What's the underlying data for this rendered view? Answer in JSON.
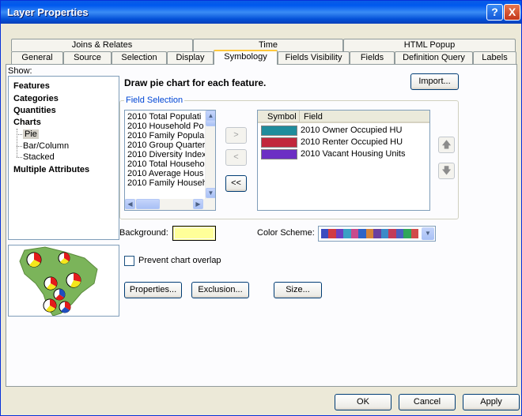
{
  "window": {
    "title": "Layer Properties"
  },
  "title_buttons": {
    "help": "?",
    "close": "X"
  },
  "tabs_row1": [
    "Joins & Relates",
    "Time",
    "HTML Popup"
  ],
  "tabs_row2": [
    "General",
    "Source",
    "Selection",
    "Display",
    "Symbology",
    "Fields Visibility",
    "Fields",
    "Definition Query",
    "Labels"
  ],
  "active_tab": "Symbology",
  "show": {
    "label": "Show:",
    "tree": {
      "features": "Features",
      "categories": "Categories",
      "quantities": "Quantities",
      "charts": "Charts",
      "pie": "Pie",
      "bar": "Bar/Column",
      "stacked": "Stacked",
      "multiple": "Multiple Attributes"
    }
  },
  "description": "Draw pie chart for each feature.",
  "import_button": "Import...",
  "field_selection": {
    "label": "Field Selection",
    "available": [
      "2010 Total Populati",
      "2010 Household Po",
      "2010 Family Populal",
      "2010 Group Quarter",
      "2010 Diversity Index",
      "2010 Total Househo",
      "2010 Average Hous",
      "2010 Family Househ"
    ],
    "move_right": ">",
    "move_left": "<",
    "remove_all": "<<",
    "columns": {
      "symbol": "Symbol",
      "field": "Field"
    },
    "selected": [
      {
        "field": "2010 Owner Occupied HU",
        "color": "#1f8c9c"
      },
      {
        "field": "2010 Renter Occupied HU",
        "color": "#c1283c"
      },
      {
        "field": "2010 Vacant Housing Units",
        "color": "#6c2fc4"
      }
    ],
    "move_up": "🡅",
    "move_down": "🡇"
  },
  "background": {
    "label": "Background:",
    "color": "#ffff99"
  },
  "color_scheme": {
    "label": "Color Scheme:",
    "colors": [
      "#3b4cc0",
      "#d03a44",
      "#6b3fc2",
      "#3aa0c4",
      "#c84a8c",
      "#2d64c8",
      "#d4823a",
      "#6a3f9f",
      "#3c8ac8",
      "#c23c5a",
      "#4a5fc0",
      "#2fa65a",
      "#d24a4a"
    ]
  },
  "prevent_overlap": {
    "label": "Prevent chart overlap",
    "checked": false
  },
  "buttons": {
    "properties": "Properties...",
    "exclusion": "Exclusion...",
    "size": "Size...",
    "ok": "OK",
    "cancel": "Cancel",
    "apply": "Apply"
  },
  "icons": {
    "help": "help-icon",
    "close": "close-icon",
    "preview": "pie-chart-map-preview"
  }
}
